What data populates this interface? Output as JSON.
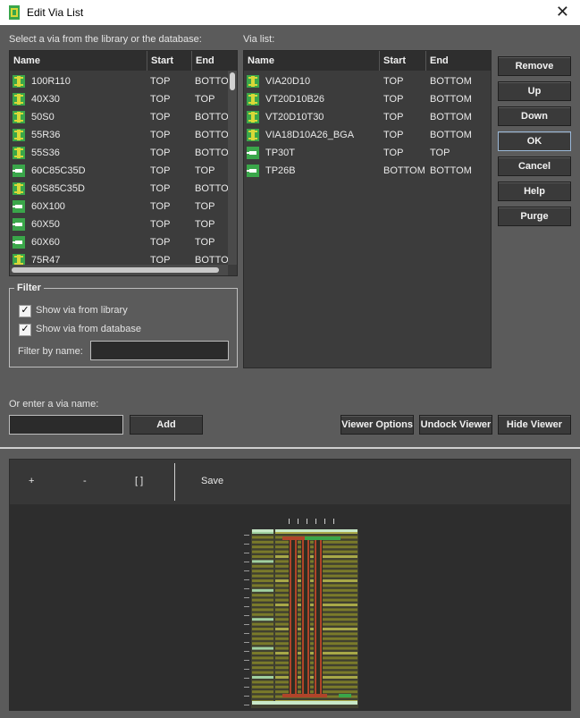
{
  "window": {
    "title": "Edit Via List",
    "close_glyph": "✕"
  },
  "library": {
    "label": "Select a via from the library or the database:",
    "columns": [
      "Name",
      "Start",
      "End"
    ],
    "rows": [
      {
        "name": "100R110",
        "start": "TOP",
        "end": "BOTTOM",
        "icon": "via-pad-icon"
      },
      {
        "name": "40X30",
        "start": "TOP",
        "end": "TOP",
        "icon": "via-pad-icon"
      },
      {
        "name": "50S0",
        "start": "TOP",
        "end": "BOTTOM",
        "icon": "via-pad-icon"
      },
      {
        "name": "55R36",
        "start": "TOP",
        "end": "BOTTOM",
        "icon": "via-pad-icon"
      },
      {
        "name": "55S36",
        "start": "TOP",
        "end": "BOTTOM",
        "icon": "via-pad-icon"
      },
      {
        "name": "60C85C35D",
        "start": "TOP",
        "end": "TOP",
        "icon": "via-smd-icon"
      },
      {
        "name": "60S85C35D",
        "start": "TOP",
        "end": "BOTTOM",
        "icon": "via-pad-icon"
      },
      {
        "name": "60X100",
        "start": "TOP",
        "end": "TOP",
        "icon": "via-smd-icon"
      },
      {
        "name": "60X50",
        "start": "TOP",
        "end": "TOP",
        "icon": "via-smd-icon"
      },
      {
        "name": "60X60",
        "start": "TOP",
        "end": "TOP",
        "icon": "via-smd-icon"
      },
      {
        "name": "75R47",
        "start": "TOP",
        "end": "BOTTOM",
        "icon": "via-pad-icon"
      }
    ]
  },
  "via_list": {
    "label": "Via list:",
    "columns": [
      "Name",
      "Start",
      "End"
    ],
    "rows": [
      {
        "name": "VIA20D10",
        "start": "TOP",
        "end": "BOTTOM",
        "icon": "via-pad-icon"
      },
      {
        "name": "VT20D10B26",
        "start": "TOP",
        "end": "BOTTOM",
        "icon": "via-pad-icon"
      },
      {
        "name": "VT20D10T30",
        "start": "TOP",
        "end": "BOTTOM",
        "icon": "via-pad-icon"
      },
      {
        "name": "VIA18D10A26_BGA",
        "start": "TOP",
        "end": "BOTTOM",
        "icon": "via-pad-icon"
      },
      {
        "name": "TP30T",
        "start": "TOP",
        "end": "TOP",
        "icon": "via-smd-icon"
      },
      {
        "name": "TP26B",
        "start": "BOTTOM",
        "end": "BOTTOM",
        "icon": "via-smd-icon"
      }
    ]
  },
  "buttons": {
    "remove": "Remove",
    "up": "Up",
    "down": "Down",
    "ok": "OK",
    "cancel": "Cancel",
    "help": "Help",
    "purge": "Purge",
    "add": "Add",
    "viewer_options": "Viewer Options",
    "undock_viewer": "Undock Viewer",
    "hide_viewer": "Hide Viewer"
  },
  "filter": {
    "title": "Filter",
    "show_library": {
      "label": "Show via from library",
      "checked": true
    },
    "show_database": {
      "label": "Show via from database",
      "checked": true
    },
    "name_label": "Filter by name:",
    "name_value": ""
  },
  "enter_via": {
    "label": "Or enter a via name:",
    "value": ""
  },
  "viewer": {
    "toolbar": {
      "zoom_in": "+",
      "zoom_out": "-",
      "fit": "[ ]",
      "save": "Save"
    }
  },
  "colors": {
    "pad_green": "#3aa64a",
    "pad_yellow": "#d8d838",
    "board_olive": "#7a7a2a",
    "trace_red": "#b0442a"
  }
}
